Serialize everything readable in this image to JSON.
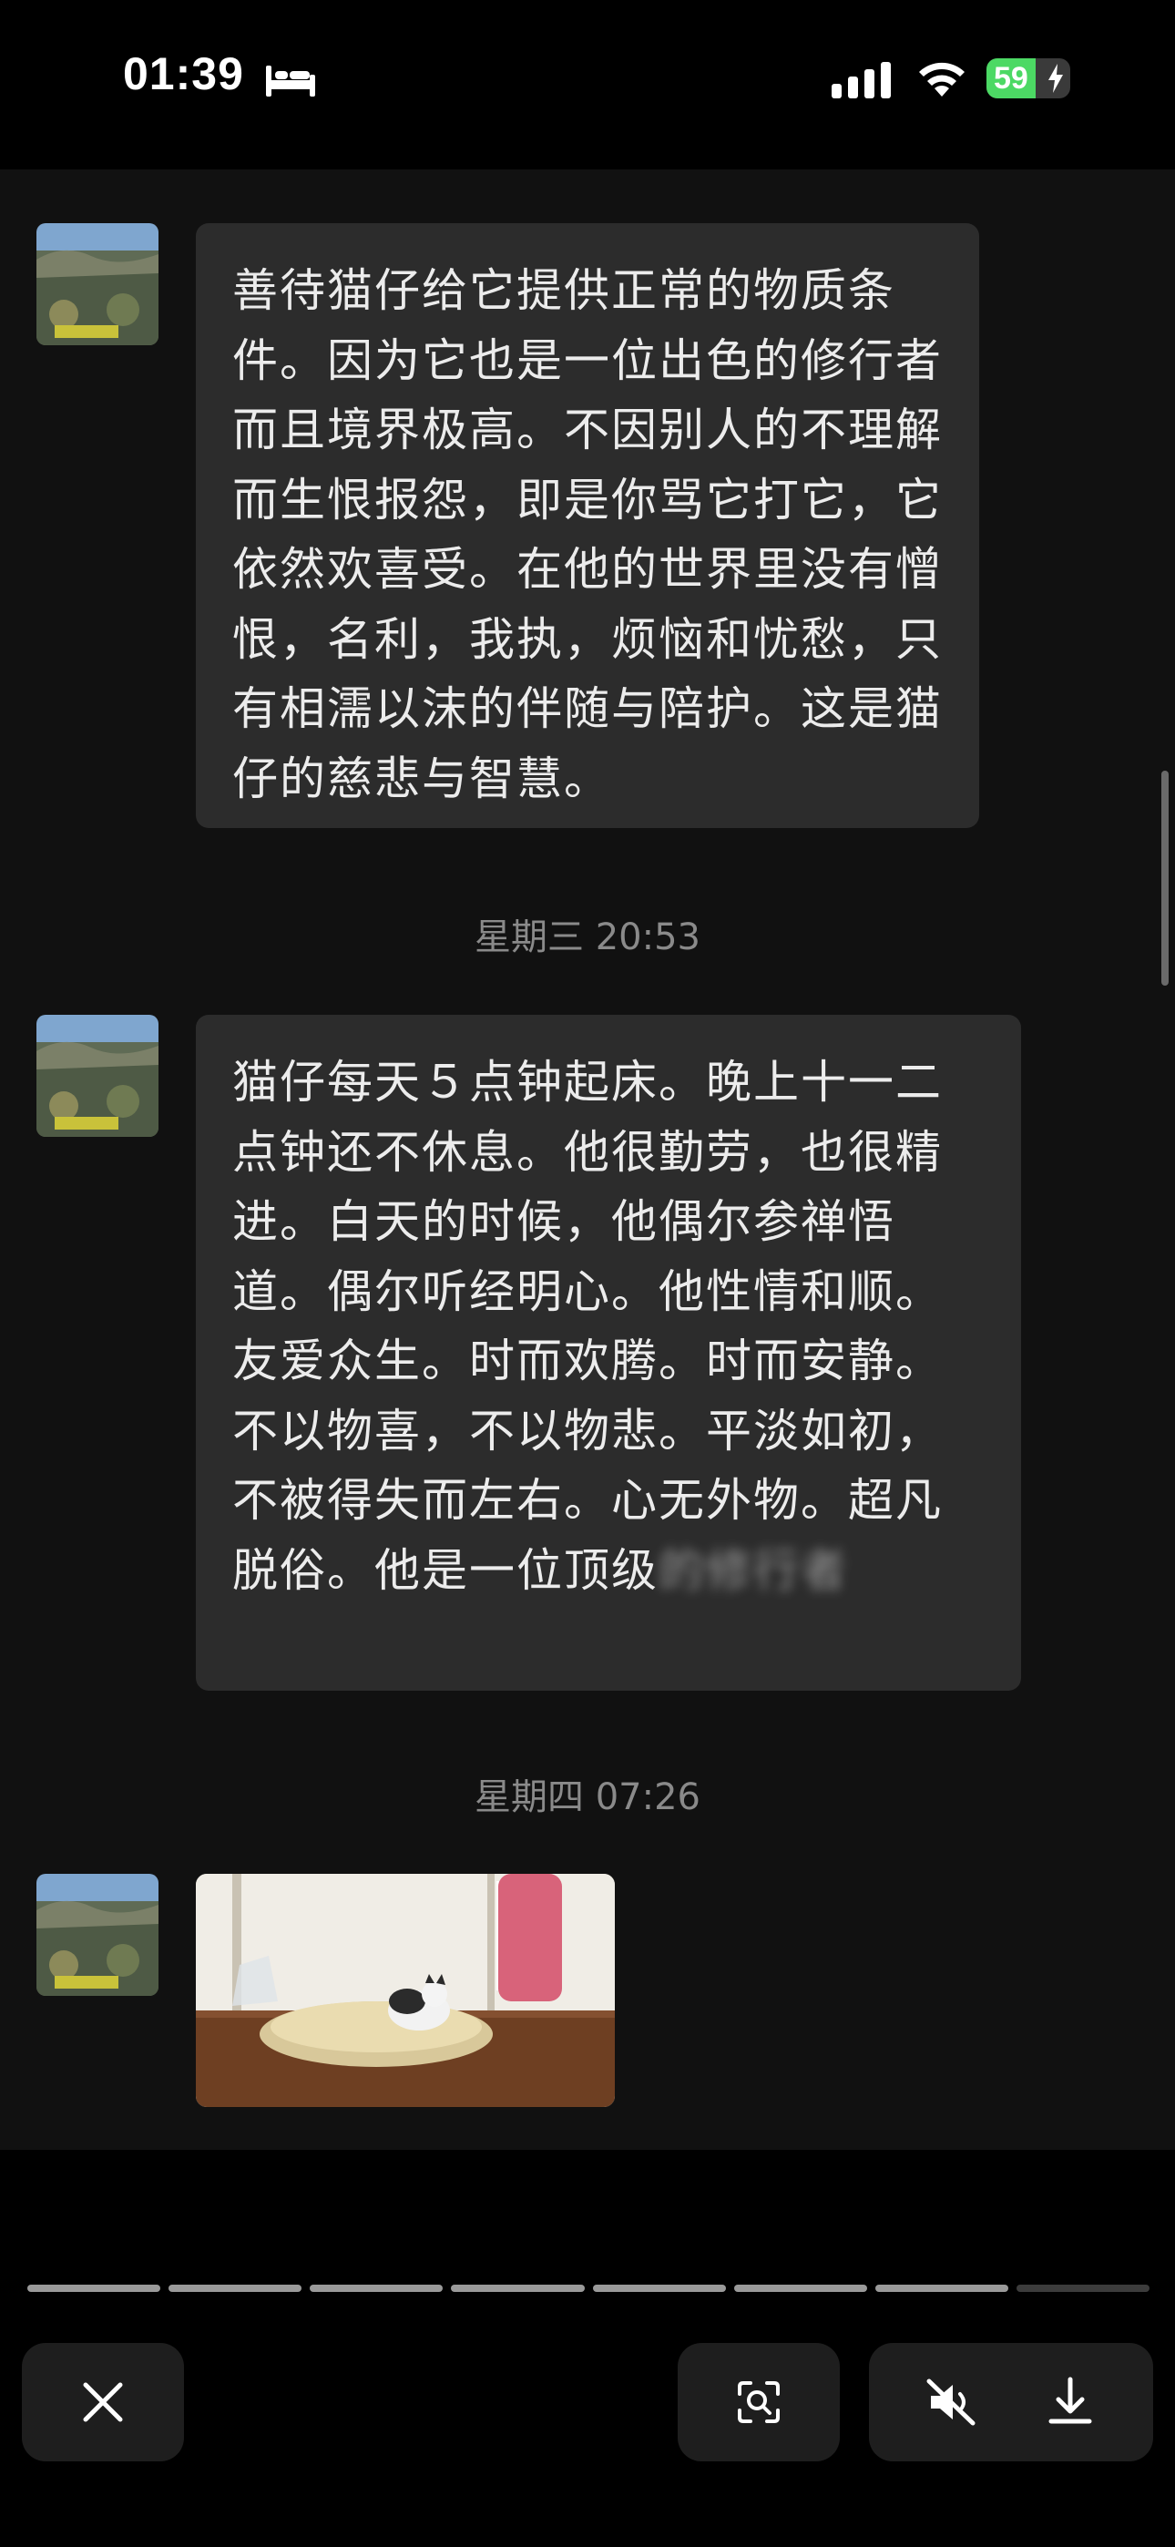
{
  "status_bar": {
    "time": "01:39",
    "battery_level": "59",
    "icons": [
      "bed-icon",
      "signal-icon",
      "wifi-icon",
      "battery-icon",
      "bolt-icon"
    ],
    "battery_color": "#4cd964"
  },
  "messages": [
    {
      "type": "text",
      "text": "善待猫仔给它提供正常的物质条件。因为它也是一位出色的修行者而且境界极高。不因别人的不理解而生恨报怨，即是你骂它打它，它依然欢喜受。在他的世界里没有憎恨，名利，我执，烦恼和忧愁，只有相濡以沫的伴随与陪护。这是猫仔的慈悲与智慧。"
    },
    {
      "type": "timestamp",
      "text": "星期三 20:53"
    },
    {
      "type": "text",
      "text": "猫仔每天５点钟起床。晚上十一二点钟还不休息。他很勤劳，也很精进。白天的时候，他偶尔参禅悟道。偶尔听经明心。他性情和顺。友爱众生。时而欢腾。时而安静。不以物喜，不以物悲。平淡如初，不被得失而左右。心无外物。超凡脱俗。他是一位顶级",
      "blurred_tail": "的修行者"
    },
    {
      "type": "timestamp",
      "text": "星期四 07:26"
    },
    {
      "type": "image",
      "subject": "cat-on-cushion-photo"
    }
  ],
  "viewer": {
    "progress_total": 8,
    "progress_current": 8,
    "buttons": [
      "close-button",
      "scan-button",
      "mute-button",
      "download-button"
    ]
  },
  "colors": {
    "bubble": "#2c2c2c",
    "chat_bg": "#111111",
    "button_bg": "#1e1e1e"
  }
}
